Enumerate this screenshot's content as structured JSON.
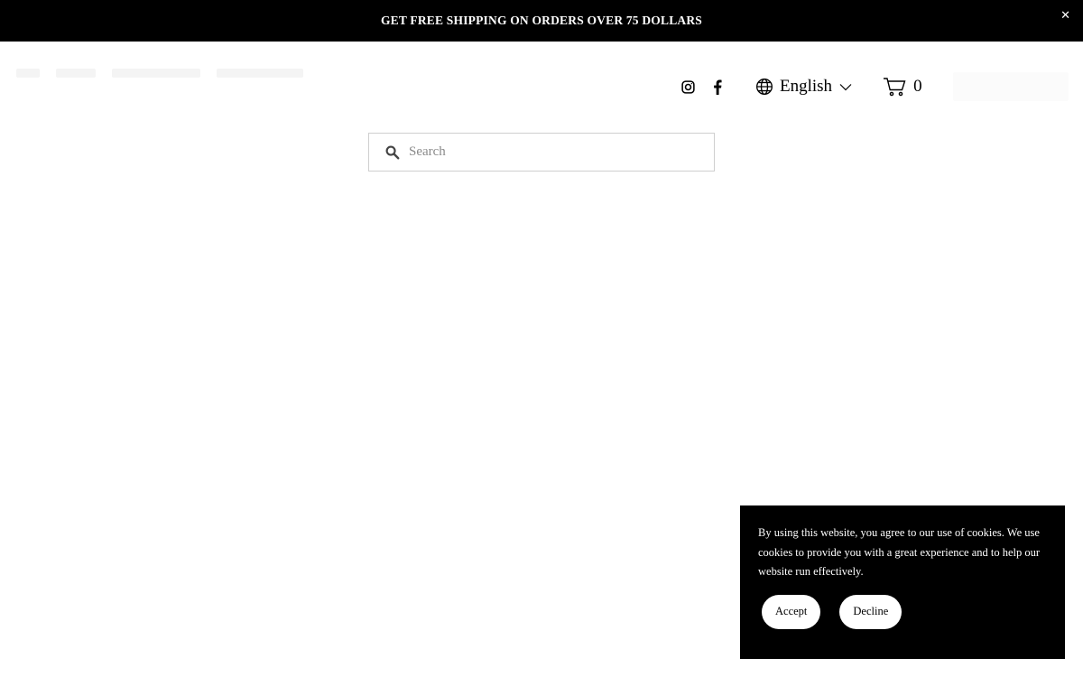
{
  "announcement": {
    "text": "GET FREE SHIPPING ON ORDERS OVER 75 DOLLARS",
    "close_label": "✕"
  },
  "header": {
    "language": {
      "label": "English"
    },
    "cart": {
      "count": "0"
    }
  },
  "search": {
    "placeholder": "Search",
    "value": ""
  },
  "cookie_banner": {
    "message": "By using this website, you agree to our use of cookies. We use cookies to provide you with a great experience and to help our website run effectively.",
    "accept_label": "Accept",
    "decline_label": "Decline"
  },
  "icons": [
    "close-icon",
    "instagram-icon",
    "facebook-icon",
    "globe-icon",
    "chevron-down-icon",
    "cart-icon",
    "search-icon"
  ]
}
